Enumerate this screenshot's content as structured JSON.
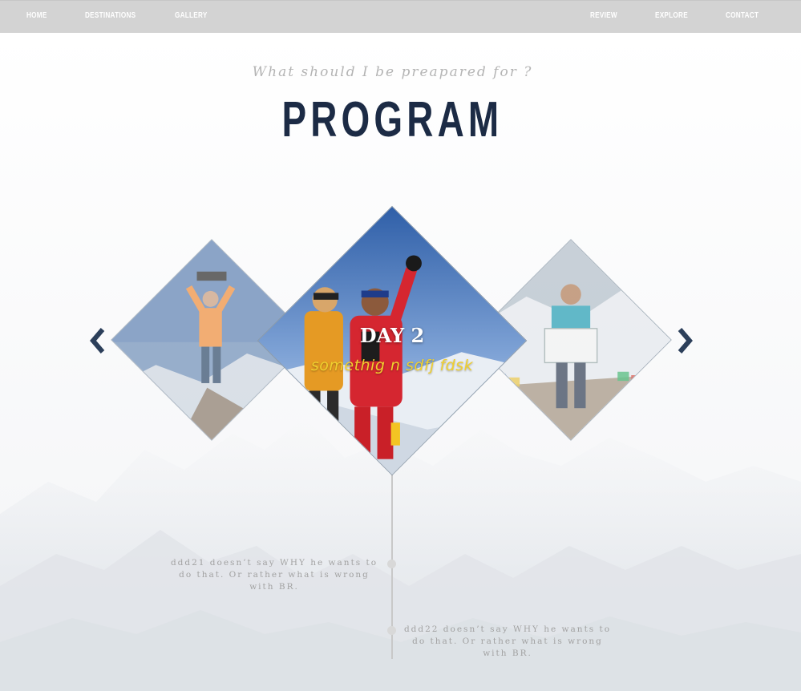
{
  "nav": {
    "left": [
      "HOME",
      "DESTINATIONS",
      "GALLERY"
    ],
    "right": [
      "REVIEW",
      "EXPLORE",
      "CONTACT"
    ]
  },
  "header": {
    "subtitle": "What should I be preapared for ?",
    "title": "PROGRAM"
  },
  "carousel": {
    "active": {
      "day": "DAY 2",
      "caption": "somethig n sdfj fdsk"
    },
    "arrows": {
      "prev_icon": "chevron-left-icon",
      "next_icon": "chevron-right-icon",
      "color": "#2c3f5a"
    }
  },
  "timeline": {
    "items": [
      "ddd21 doesn’t say WHY he wants to do that. Or rather what is wrong with BR.",
      "ddd22 doesn’t say WHY he wants to do that. Or rather what is wrong with BR."
    ]
  },
  "colors": {
    "nav_bg": "#d3d3d3",
    "title": "#1c2b45",
    "caption": "#f0cf2e"
  }
}
